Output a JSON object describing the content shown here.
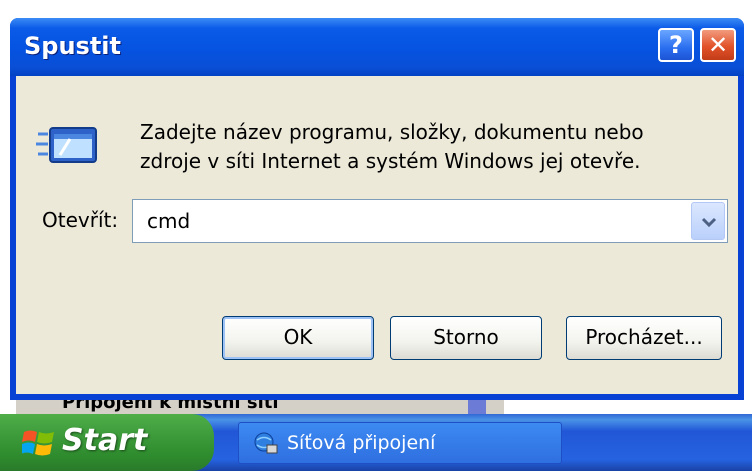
{
  "window": {
    "title": "Spustit",
    "help_glyph": "?",
    "close_glyph": "✕"
  },
  "dialog": {
    "description_line1": "Zadejte název programu, složky, dokumentu nebo",
    "description_line2": "zdroje v síti Internet a systém Windows jej otevře.",
    "open_label": "Otevřít:",
    "open_value": "cmd",
    "ok_label": "OK",
    "cancel_label": "Storno",
    "browse_label": "Procházet..."
  },
  "background_window": {
    "partial_text": "Připojení k místní síti"
  },
  "taskbar": {
    "start_label": "Start",
    "task_label": "Síťová připojení"
  },
  "colors": {
    "titlebar": "#0553e0",
    "client": "#ece9d8",
    "close_red": "#e2532a",
    "taskbar_blue": "#2663e0",
    "start_green": "#3c9a3a"
  },
  "icons": [
    "run-icon",
    "help-icon",
    "close-icon",
    "dropdown-arrow-icon",
    "windows-logo-icon",
    "network-connections-icon"
  ]
}
